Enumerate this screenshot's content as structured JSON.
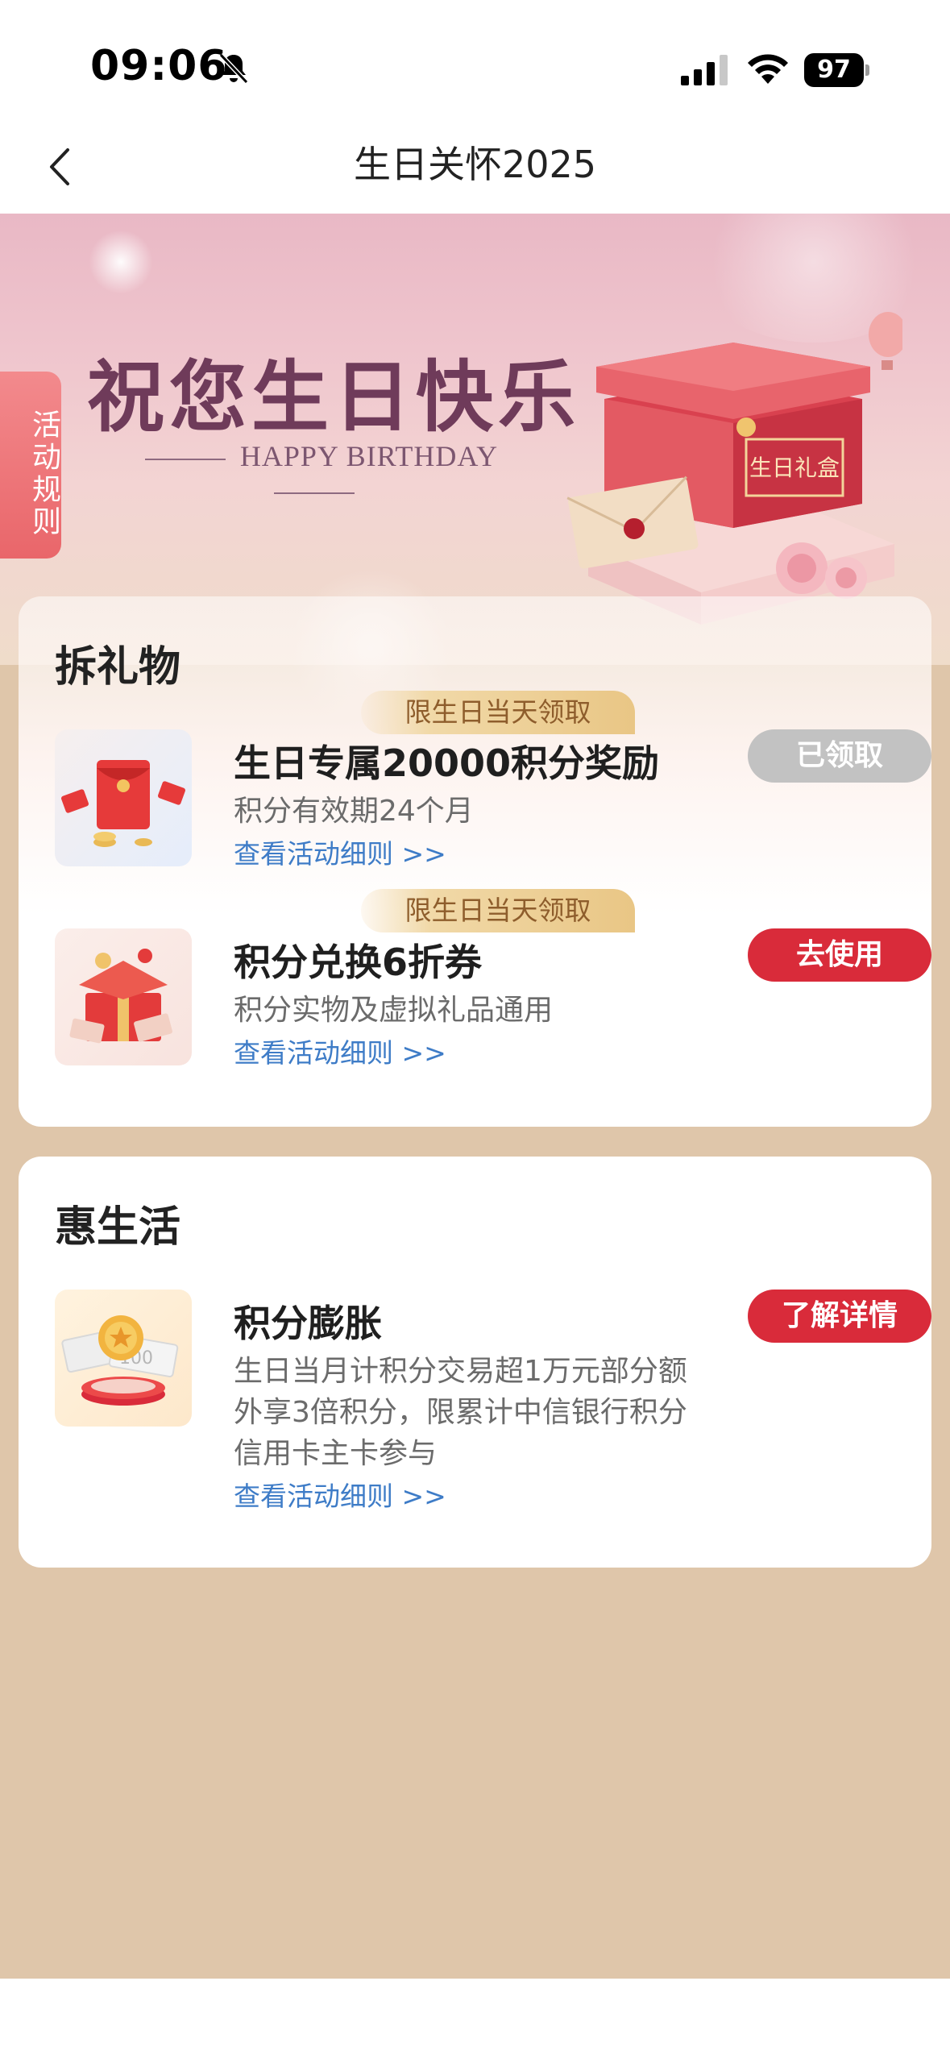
{
  "status_bar": {
    "time": "09:06",
    "battery": "97",
    "icons": [
      "bell-muted-icon",
      "signal-icon",
      "wifi-icon",
      "battery-icon"
    ]
  },
  "nav": {
    "title": "生日关怀2025",
    "back_icon": "chevron-left-icon"
  },
  "hero": {
    "title": "祝您生日快乐",
    "subtitle": "HAPPY BIRTHDAY",
    "gift_box_label": "生日礼盒",
    "rules_tab": "活动规则"
  },
  "gift_section": {
    "title": "拆礼物",
    "items": [
      {
        "tag": "限生日当天领取",
        "title": "生日专属20000积分奖励",
        "desc": "积分有效期24个月",
        "link": "查看活动细则 >>",
        "button": "已领取",
        "button_state": "disabled"
      },
      {
        "tag": "限生日当天领取",
        "title": "积分兑换6折券",
        "desc": "积分实物及虚拟礼品通用",
        "link": "查看活动细则 >>",
        "button": "去使用",
        "button_state": "active"
      }
    ]
  },
  "life_section": {
    "title": "惠生活",
    "items": [
      {
        "title": "积分膨胀",
        "desc_lines": [
          "生日当月计积分交易超1万元部分额",
          "外享3倍积分，限累计中信银行积分",
          "信用卡主卡参与"
        ],
        "link": "查看活动细则 >>",
        "button": "了解详情",
        "thumb_text": "100"
      }
    ]
  },
  "colors": {
    "page_bg": "#dfc6aa",
    "accent_red": "#d92b3a",
    "disabled_gray": "#c2c2c2",
    "link_blue": "#3e7cc7",
    "tag_gold": "#e9c685"
  }
}
